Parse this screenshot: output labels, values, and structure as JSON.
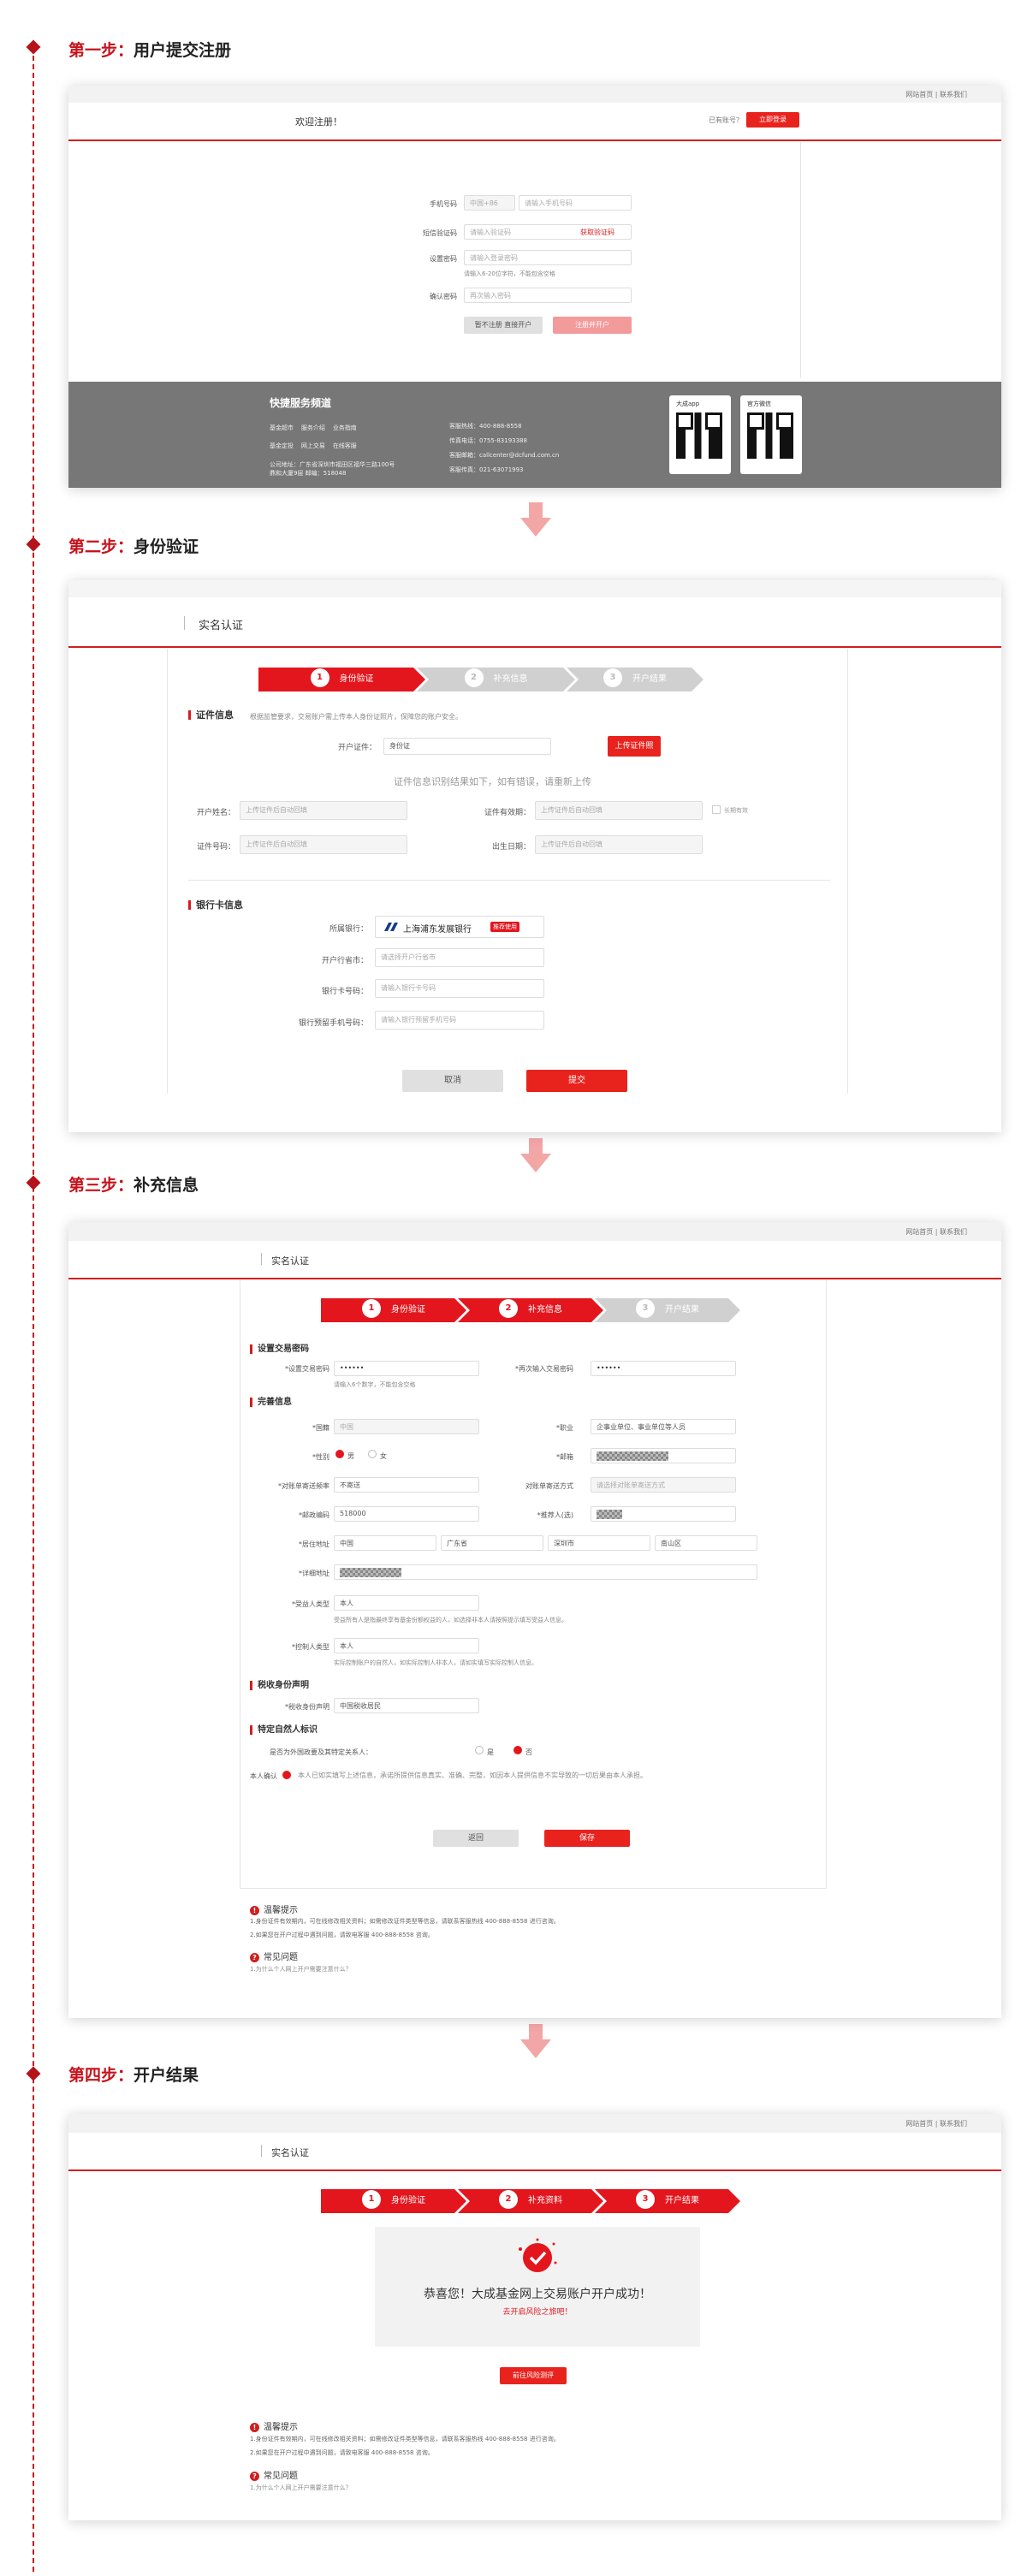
{
  "steps": [
    "第一步：",
    "第二步：",
    "第三步：",
    "第四步："
  ],
  "step_names": [
    "用户提交注册",
    "身份验证",
    "补充信息",
    "开户结果"
  ],
  "s1": {
    "top_links": "网站首页 | 联系我们",
    "welcome": "欢迎注册！",
    "login_q": "已有账号？",
    "login_btn": "立即登录",
    "f_phone": "手机号码",
    "f_area": "中国+86",
    "f_phone_ph": "请输入手机号码",
    "f_code": "短信验证码",
    "f_code_ph": "请输入验证码",
    "f_get": "获取验证码",
    "f_pwd": "设置密码",
    "f_pwd_ph": "请输入登录密码",
    "f_pwd_hint": "请输入6-20位字符，不能包含空格",
    "f_pwd2": "确认密码",
    "f_pwd2_ph": "再次输入密码",
    "skip": "暂不注册 直接开户",
    "register": "注册并开户",
    "brand": "快捷服务频道",
    "col1": [
      "基金超市",
      "服务介绍",
      "业务指南",
      "基金定投",
      "网上交易",
      "在线客服"
    ],
    "addr": "公司地址：广东省深圳市福田区福华三路100号",
    "addr2": "鼎和大厦9层 邮编：518048",
    "contacts": [
      "客服热线：400-888-8558",
      "传真电话：0755-83193388",
      "客服邮箱：callcenter@dcfund.com.cn",
      "客服传真：021-63071993"
    ],
    "qr1": "大成app",
    "qr2": "官方微信"
  },
  "s2": {
    "title": "实名认证",
    "steps": [
      "身份验证",
      "补充信息",
      "开户结果"
    ],
    "id_sec": "证件信息",
    "id_desc": "根据监管要求，交易账户需上传本人身份证照片，保障您的账户安全。",
    "id_type_l": "开户证件：",
    "id_type": "身份证",
    "upload": "上传证件照",
    "result_hint": "证件信息识别结果如下，如有错误，请重新上传",
    "name_l": "开户姓名：",
    "name_ph": "上传证件后自动回填",
    "valid_l": "证件有效期：",
    "valid_ph": "上传证件后自动回填",
    "longterm": "长期有效",
    "idno_l": "证件号码：",
    "idno_ph": "上传证件后自动回填",
    "birth_l": "出生日期：",
    "birth_ph": "上传证件后自动回填",
    "bank_sec": "银行卡信息",
    "bank_l": "所属银行：",
    "bank": "上海浦东发展银行",
    "bank_tag": "推荐使用",
    "branch_l": "开户行省市：",
    "branch_ph": "请选择开户行省市",
    "card_l": "银行卡号码：",
    "card_ph": "请输入银行卡号码",
    "mobile_l": "银行预留手机号码：",
    "mobile_ph": "请输入银行预留手机号码",
    "cancel": "取消",
    "submit": "提交"
  },
  "s3": {
    "title": "实名认证",
    "steps": [
      "身份验证",
      "补充信息",
      "开户结果"
    ],
    "sec1": "设置交易密码",
    "tp_l": "*设置交易密码",
    "tp_v": "••••••",
    "tp2_l": "*再次输入交易密码",
    "tp2_v": "••••••",
    "tp_hint": "请输入6个数字，不能包含空格",
    "sec2": "完善信息",
    "nat_l": "*国籍",
    "nat_v": "中国",
    "job_l": "*职业",
    "job_v": "企事业单位、事业单位等人员",
    "sex_l": "*性别",
    "male": "男",
    "female": "女",
    "email_l": "*邮箱",
    "rec_l": "*对账单寄送频率",
    "rec_v": "不寄送",
    "recm_l": "对账单寄送方式",
    "recm_v": "请选择对账单寄送方式",
    "zip_l": "*邮政编码",
    "zip_v": "518000",
    "ref_l": "*推荐人(选)",
    "addr_l": "*居住地址",
    "country": "中国",
    "prov": "广东省",
    "city": "深圳市",
    "dist": "南山区",
    "detail_l": "*详细地址",
    "benef_l": "*受益人类型",
    "benef_v": "本人",
    "benef_note": "受益所有人是指最终享有基金份额权益的人，如选择非本人请按照提示填写受益人信息。",
    "ctrl_l": "*控制人类型",
    "ctrl_v": "本人",
    "ctrl_note": "实际控制账户的自然人，如实际控制人非本人，请如实填写实际控制人信息。",
    "sec3": "税收身份声明",
    "tax_l": "*税收身份声明",
    "tax_v": "中国税收居民",
    "sec4": "特定自然人标识",
    "q": "是否为外国政要及其特定关系人：",
    "yes": "是",
    "no": "否",
    "agree_l": "本人确认",
    "agree": "本人已如实填写上述信息，承诺所提供信息真实、准确、完整，如因本人提供信息不实导致的一切后果由本人承担。",
    "back": "返回",
    "save": "保存",
    "tip": "温馨提示",
    "tip1": "1.身份证件有效期内，可在线修改相关资料；如需修改证件类型等信息，请联系客服热线 400-888-8558 进行咨询。",
    "tip2": "2.如果您在开户过程中遇到问题，请致电客服 400-888-8558 咨询。",
    "faq": "常见问题",
    "faq1": "1.为什么个人网上开户需要注意什么？"
  },
  "s4": {
    "title": "实名认证",
    "steps": [
      "身份验证",
      "补充资料",
      "开户结果"
    ],
    "success": "恭喜您！大成基金网上交易账户开户成功！",
    "sub": "去开启风险之旅吧！",
    "btn": "前往风险测评",
    "tip": "温馨提示",
    "tip1": "1.身份证件有效期内，可在线修改相关资料；如需修改证件类型等信息，请联系客服热线 400-888-8558 进行咨询。",
    "tip2": "2.如果您在开户过程中遇到问题，请致电客服 400-888-8558 咨询。",
    "faq": "常见问题",
    "faq1": "1.为什么个人网上开户需要注意什么？"
  }
}
